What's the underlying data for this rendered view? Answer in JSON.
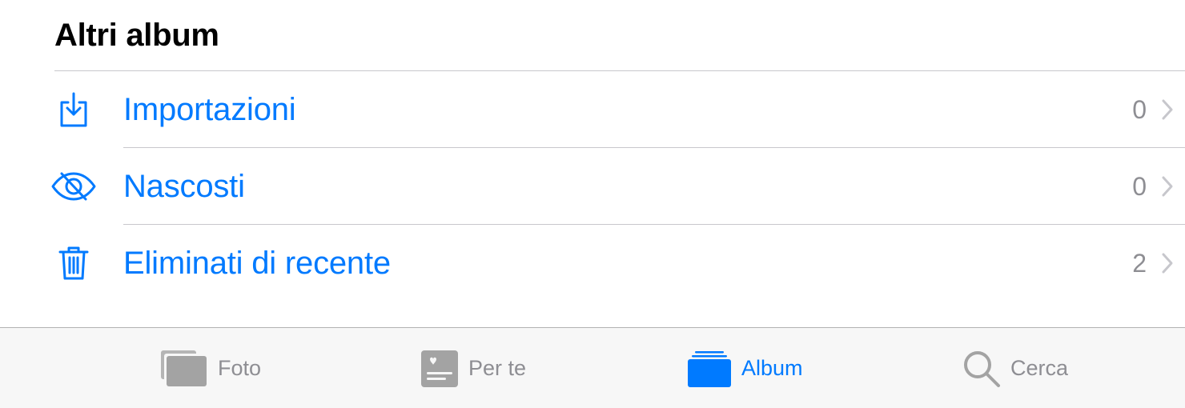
{
  "section": {
    "title": "Altri album"
  },
  "albums": [
    {
      "label": "Importazioni",
      "count": "0",
      "icon": "import-icon"
    },
    {
      "label": "Nascosti",
      "count": "0",
      "icon": "hidden-eye-icon"
    },
    {
      "label": "Eliminati di recente",
      "count": "2",
      "icon": "trash-icon"
    }
  ],
  "tab_bar": {
    "tabs": [
      {
        "label": "Foto",
        "icon": "photos-icon",
        "active": false
      },
      {
        "label": "Per te",
        "icon": "for-you-icon",
        "active": false
      },
      {
        "label": "Album",
        "icon": "albums-icon",
        "active": true
      },
      {
        "label": "Cerca",
        "icon": "search-icon",
        "active": false
      }
    ]
  },
  "colors": {
    "accent": "#007aff",
    "secondary_text": "#8e8e93",
    "inactive_icon": "#a3a3a3",
    "separator": "#c8c7cc",
    "tab_bar_background": "#f7f7f7"
  }
}
